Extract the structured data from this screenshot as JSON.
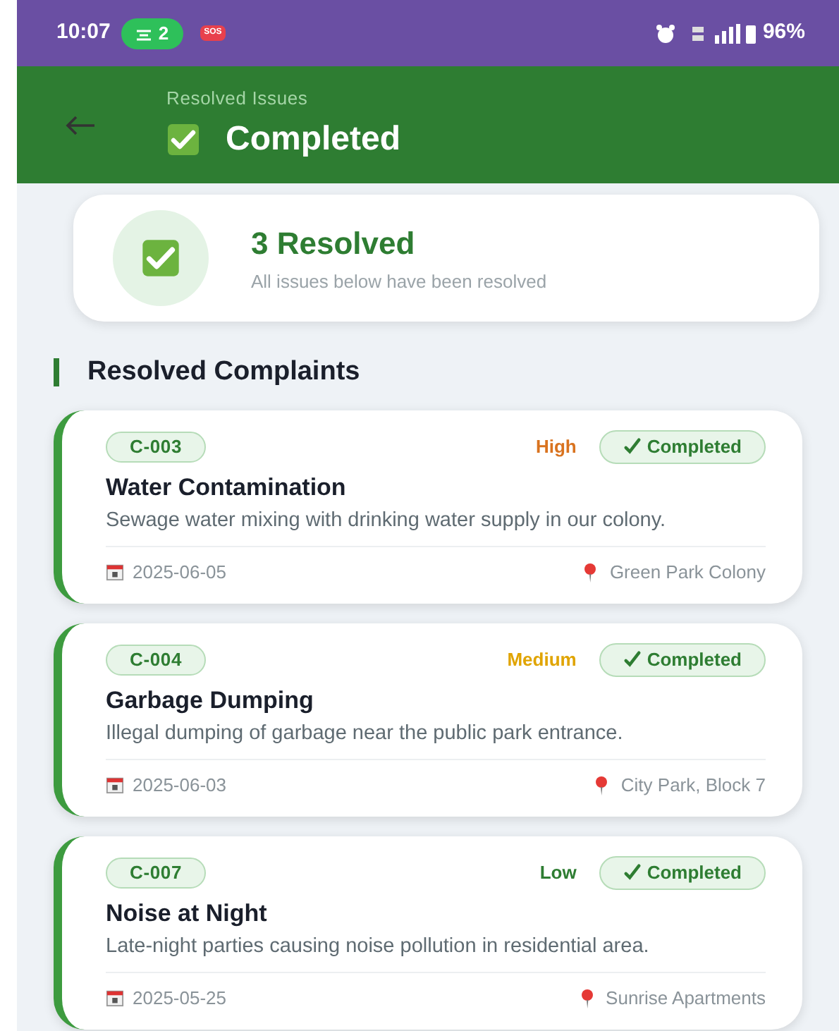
{
  "status_bar": {
    "time": "10:07",
    "hotspot_count": "2",
    "sos": "SOS",
    "battery": "96%"
  },
  "header": {
    "subtitle": "Resolved Issues",
    "title": "Completed"
  },
  "summary": {
    "count": "3 Resolved",
    "caption": "All issues below have been resolved"
  },
  "section_title": "Resolved Complaints",
  "complaints": [
    {
      "id": "C-003",
      "priority": {
        "text": "High",
        "color": "#d9731f"
      },
      "status": "Completed",
      "title": "Water Contamination",
      "description": "Sewage water mixing with drinking water supply in our colony.",
      "date": "2025-06-05",
      "location": "Green Park Colony"
    },
    {
      "id": "C-004",
      "priority": {
        "text": "Medium",
        "color": "#e0a400"
      },
      "status": "Completed",
      "title": "Garbage Dumping",
      "description": "Illegal dumping of garbage near the public park entrance.",
      "date": "2025-06-03",
      "location": "City Park, Block 7"
    },
    {
      "id": "C-007",
      "priority": {
        "text": "Low",
        "color": "#2e7d32"
      },
      "status": "Completed",
      "title": "Noise at Night",
      "description": "Late-night parties causing noise pollution in residential area.",
      "date": "2025-05-25",
      "location": "Sunrise Apartments"
    }
  ]
}
